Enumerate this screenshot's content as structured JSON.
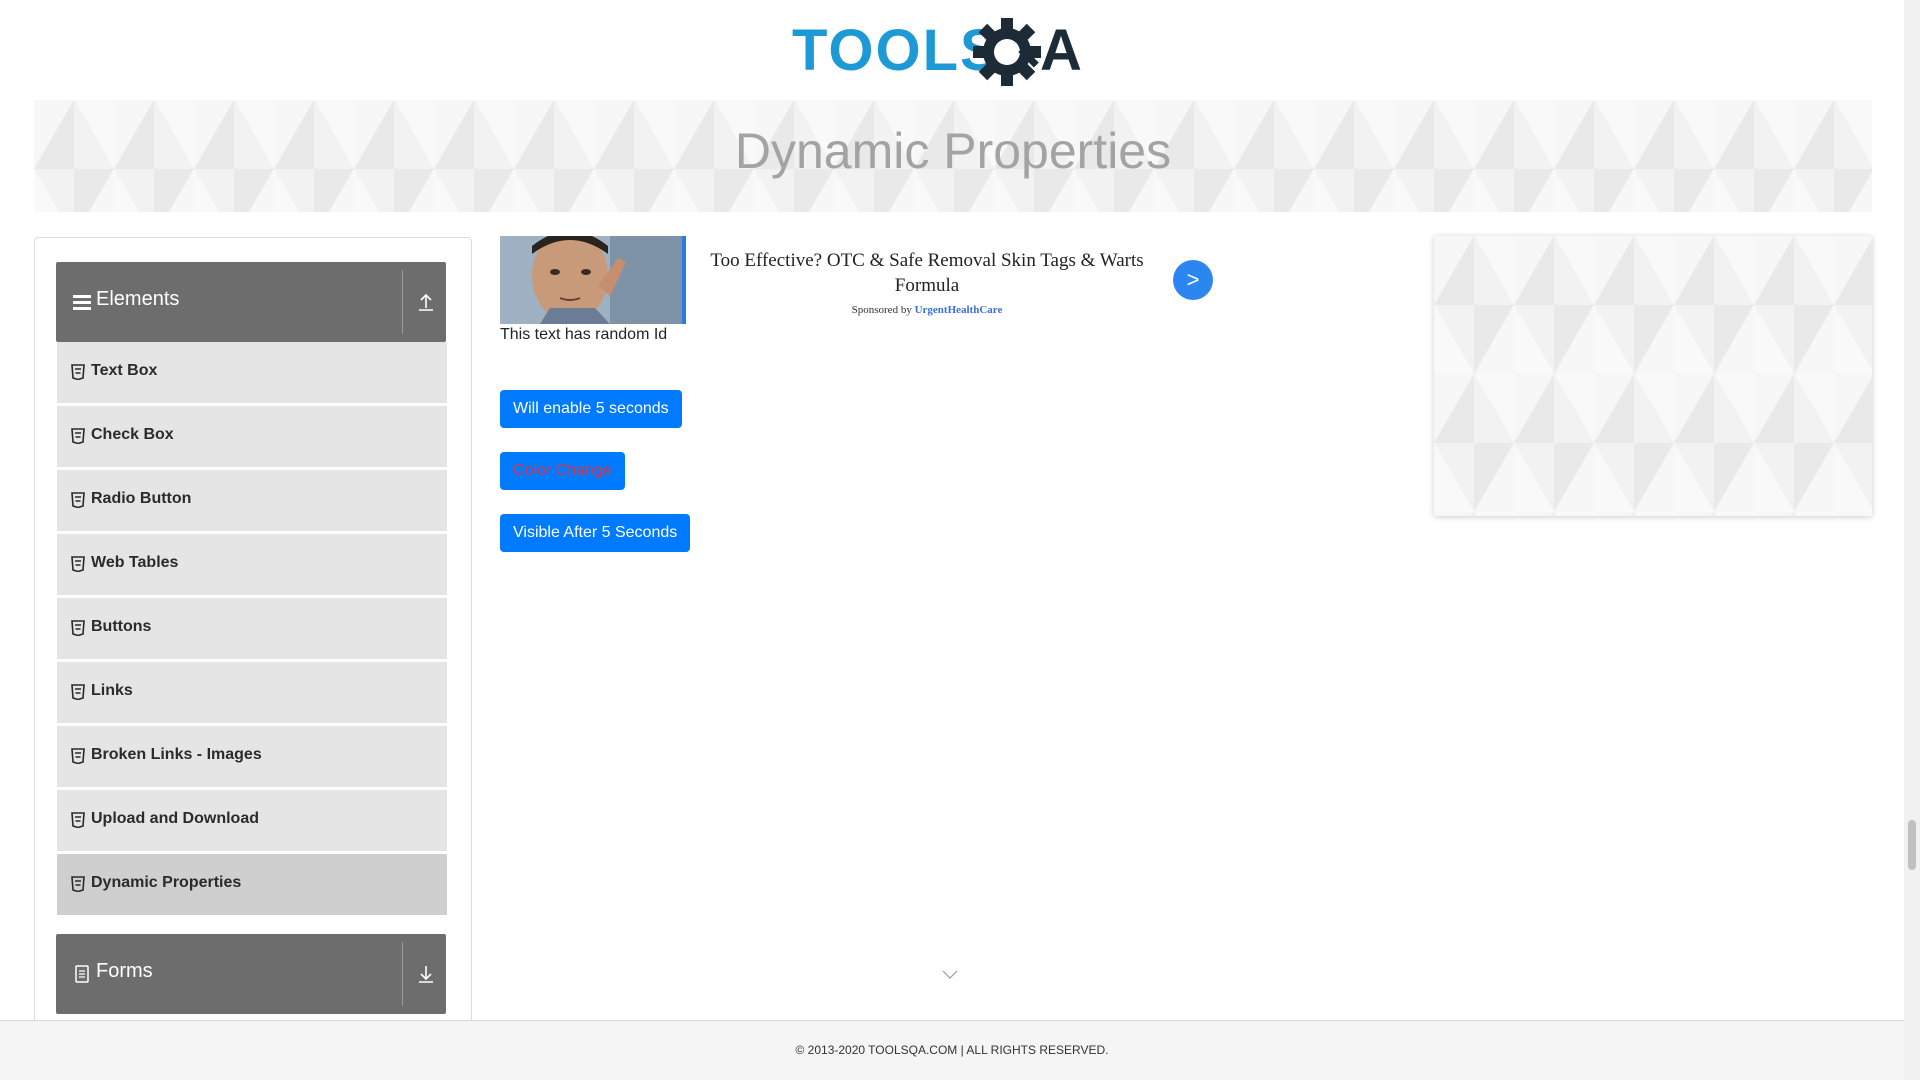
{
  "header": {
    "logo_text_left": "TOOLS",
    "logo_text_right": "QA",
    "page_title": "Dynamic Properties"
  },
  "sidebar": {
    "elements_group": {
      "label": "Elements",
      "expanded": true,
      "items": [
        {
          "label": "Text Box"
        },
        {
          "label": "Check Box"
        },
        {
          "label": "Radio Button"
        },
        {
          "label": "Web Tables"
        },
        {
          "label": "Buttons"
        },
        {
          "label": "Links"
        },
        {
          "label": "Broken Links - Images"
        },
        {
          "label": "Upload and Download"
        },
        {
          "label": "Dynamic Properties",
          "active": true
        }
      ]
    },
    "forms_group": {
      "label": "Forms",
      "expanded": false
    }
  },
  "ad": {
    "title": "Too Effective? OTC & Safe Removal Skin Tags & Warts Formula",
    "sponsored_by": "Sponsored by",
    "brand": "UrgentHealthCare",
    "arrow": ">"
  },
  "main": {
    "random_id_text": "This text has random Id",
    "enable_after_button": "Will enable 5 seconds",
    "color_change_button": "Color Change",
    "visible_after_button": "Visible After 5 Seconds"
  },
  "footer": {
    "text": "© 2013-2020 TOOLSQA.COM | ALL RIGHTS RESERVED."
  },
  "colors": {
    "primary": "#007bff",
    "danger_text": "#dc3545",
    "sidebar_header": "#6d6d6d",
    "sidebar_item": "#e5e5e5",
    "logo_blue": "#1d9ad6",
    "logo_dark": "#1d2b36"
  }
}
